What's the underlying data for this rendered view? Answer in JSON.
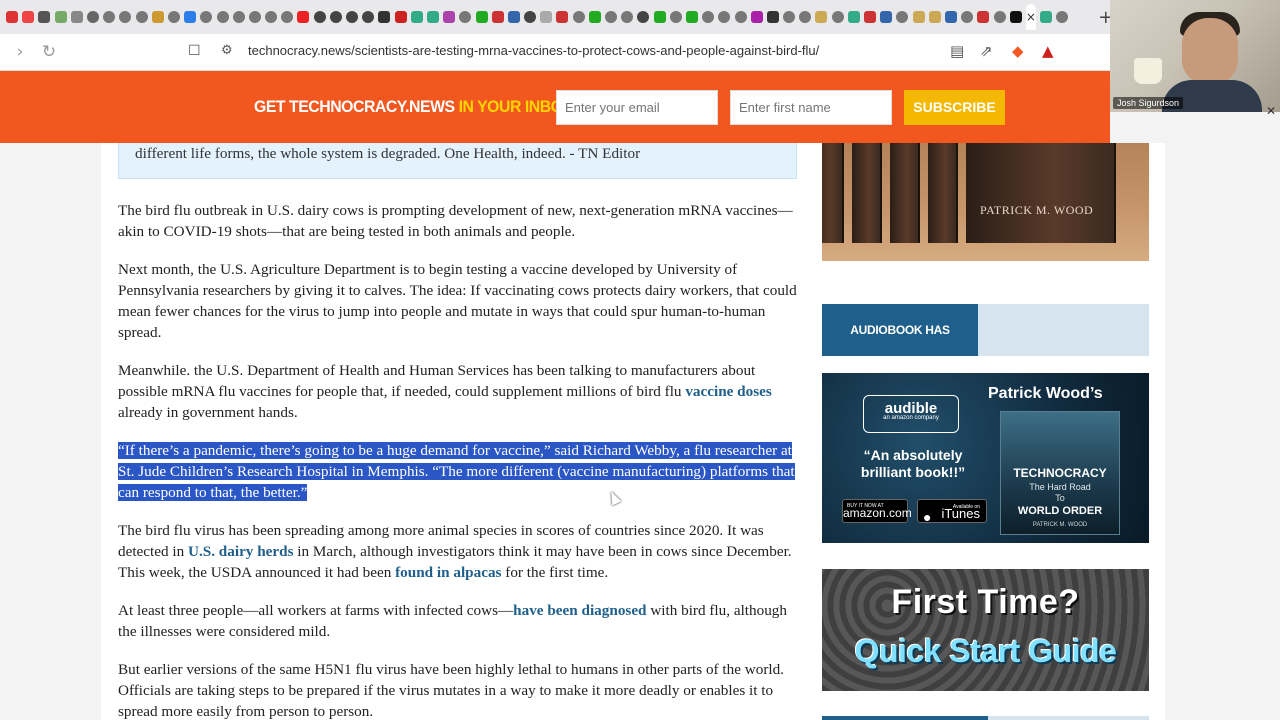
{
  "browser": {
    "address_url": "technocracy.news/scientists-are-testing-mrna-vaccines-to-protect-cows-and-people-against-bird-flu/",
    "active_tab_close": "×",
    "new_tab": "+"
  },
  "webcam": {
    "name": "Josh Sigurdson"
  },
  "banner": {
    "text_white": "GET TECHNOCRACY.NEWS ",
    "text_yellow": "IN YOUR INBOX!",
    "email_placeholder": "Enter your email",
    "name_placeholder": "Enter first name",
    "subscribe_label": "SUBSCRIBE"
  },
  "editor_note": {
    "text": "different life forms, the whole system is degraded. One Health, indeed. - TN Editor"
  },
  "article": {
    "p1": "The bird flu outbreak in U.S. dairy cows is prompting development of new, next-generation mRNA vaccines—akin to COVID-19 shots—that are being tested in both animals and people.",
    "p2": "Next month, the U.S. Agriculture Department is to begin testing a vaccine developed by University of Pennsylvania researchers by giving it to calves. The idea: If vaccinating cows protects dairy workers, that could mean fewer chances for the virus to jump into people and mutate in ways that could spur human-to-human spread.",
    "p3_a": "Meanwhile. the U.S. Department of Health and Human Services has been talking to manufacturers about possible mRNA flu vaccines for people that, if needed, could supplement millions of bird flu ",
    "p3_link": "vaccine doses",
    "p3_b": " already in government hands.",
    "p4": "“If there’s a pandemic, there’s going to be a huge demand for vaccine,” said Richard Webby, a flu researcher at St. Jude Children’s Research Hospital in Memphis. “The more different (vaccine manufacturing) platforms that can respond to that, the better.”",
    "p5_a": "The bird flu virus has been spreading among more animal species in scores of countries since 2020. It was detected in ",
    "p5_link1": "U.S. dairy herds",
    "p5_b": " in March, although investigators think it may have been in cows since December. This week, the USDA announced it had been ",
    "p5_link2": "found in alpacas",
    "p5_c": " for the first time.",
    "p6_a": "At least three people—all workers at farms with infected cows—",
    "p6_link": "have been diagnosed",
    "p6_b": " with bird flu, although the illnesses were considered mild.",
    "p7": "But earlier versions of the same H5N1 flu virus have been highly lethal to humans in other parts of the world. Officials are taking steps to be prepared if the virus mutates in a way to make it more deadly or enables it to spread more easily from person to person."
  },
  "sidebar": {
    "book_author": "PATRICK M. WOOD",
    "audiobook_label": "AUDIOBOOK HAS ARRIVED!",
    "ad1": {
      "audible": "audible",
      "audible_sub": "an amazon company",
      "quote": "“An absolutely brilliant book!!”",
      "amazon_small": "BUY IT NOW AT",
      "amazon": "amazon.com",
      "itunes_small": "Available on",
      "itunes": "iTunes",
      "author": "Patrick Wood’s",
      "cover_title": "TECHNOCRACY",
      "cover_sub1": "The Hard Road",
      "cover_sub2": "To",
      "cover_sub3": "WORLD ORDER",
      "cover_author": "PATRICK M. WOOD"
    },
    "ad2": {
      "line1": "First Time?",
      "line2": "Quick Start Guide"
    }
  },
  "colors": {
    "banner": "#f1571e",
    "banner_highlight": "#ffd400",
    "subscribe": "#f5b800",
    "link": "#1f5f8b",
    "selection": "#2a56c6"
  }
}
